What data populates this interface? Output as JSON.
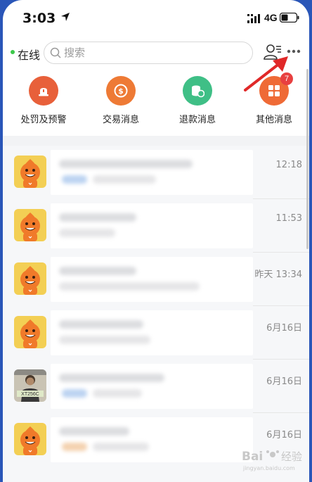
{
  "status_bar": {
    "time": "3:03",
    "network": "4G"
  },
  "header": {
    "status_label": "在线",
    "search_placeholder": "搜索"
  },
  "categories": [
    {
      "label": "处罚及预警",
      "color": "#e8603a",
      "icon": "warning-lamp-icon"
    },
    {
      "label": "交易消息",
      "color": "#ee7a35",
      "icon": "coin-icon"
    },
    {
      "label": "退款消息",
      "color": "#3fbf86",
      "icon": "refund-icon"
    },
    {
      "label": "其他消息",
      "color": "#ef6a36",
      "icon": "grid-icon",
      "badge": "7"
    }
  ],
  "messages": [
    {
      "time": "12:18",
      "avatar": "mascot"
    },
    {
      "time": "11:53",
      "avatar": "mascot"
    },
    {
      "time": "昨天 13:34",
      "avatar": "mascot"
    },
    {
      "time": "6月16日",
      "avatar": "mascot"
    },
    {
      "time": "6月16日",
      "avatar": "photo",
      "avatar_text": "XT256C"
    },
    {
      "time": "6月16日",
      "avatar": "mascot"
    }
  ],
  "watermark": {
    "text": "Bai 经验",
    "sub": "jingyan.baidu.com"
  },
  "colors": {
    "accent_red": "#e02828",
    "online_green": "#3cc84a",
    "frame_blue": "#2a56b8"
  }
}
